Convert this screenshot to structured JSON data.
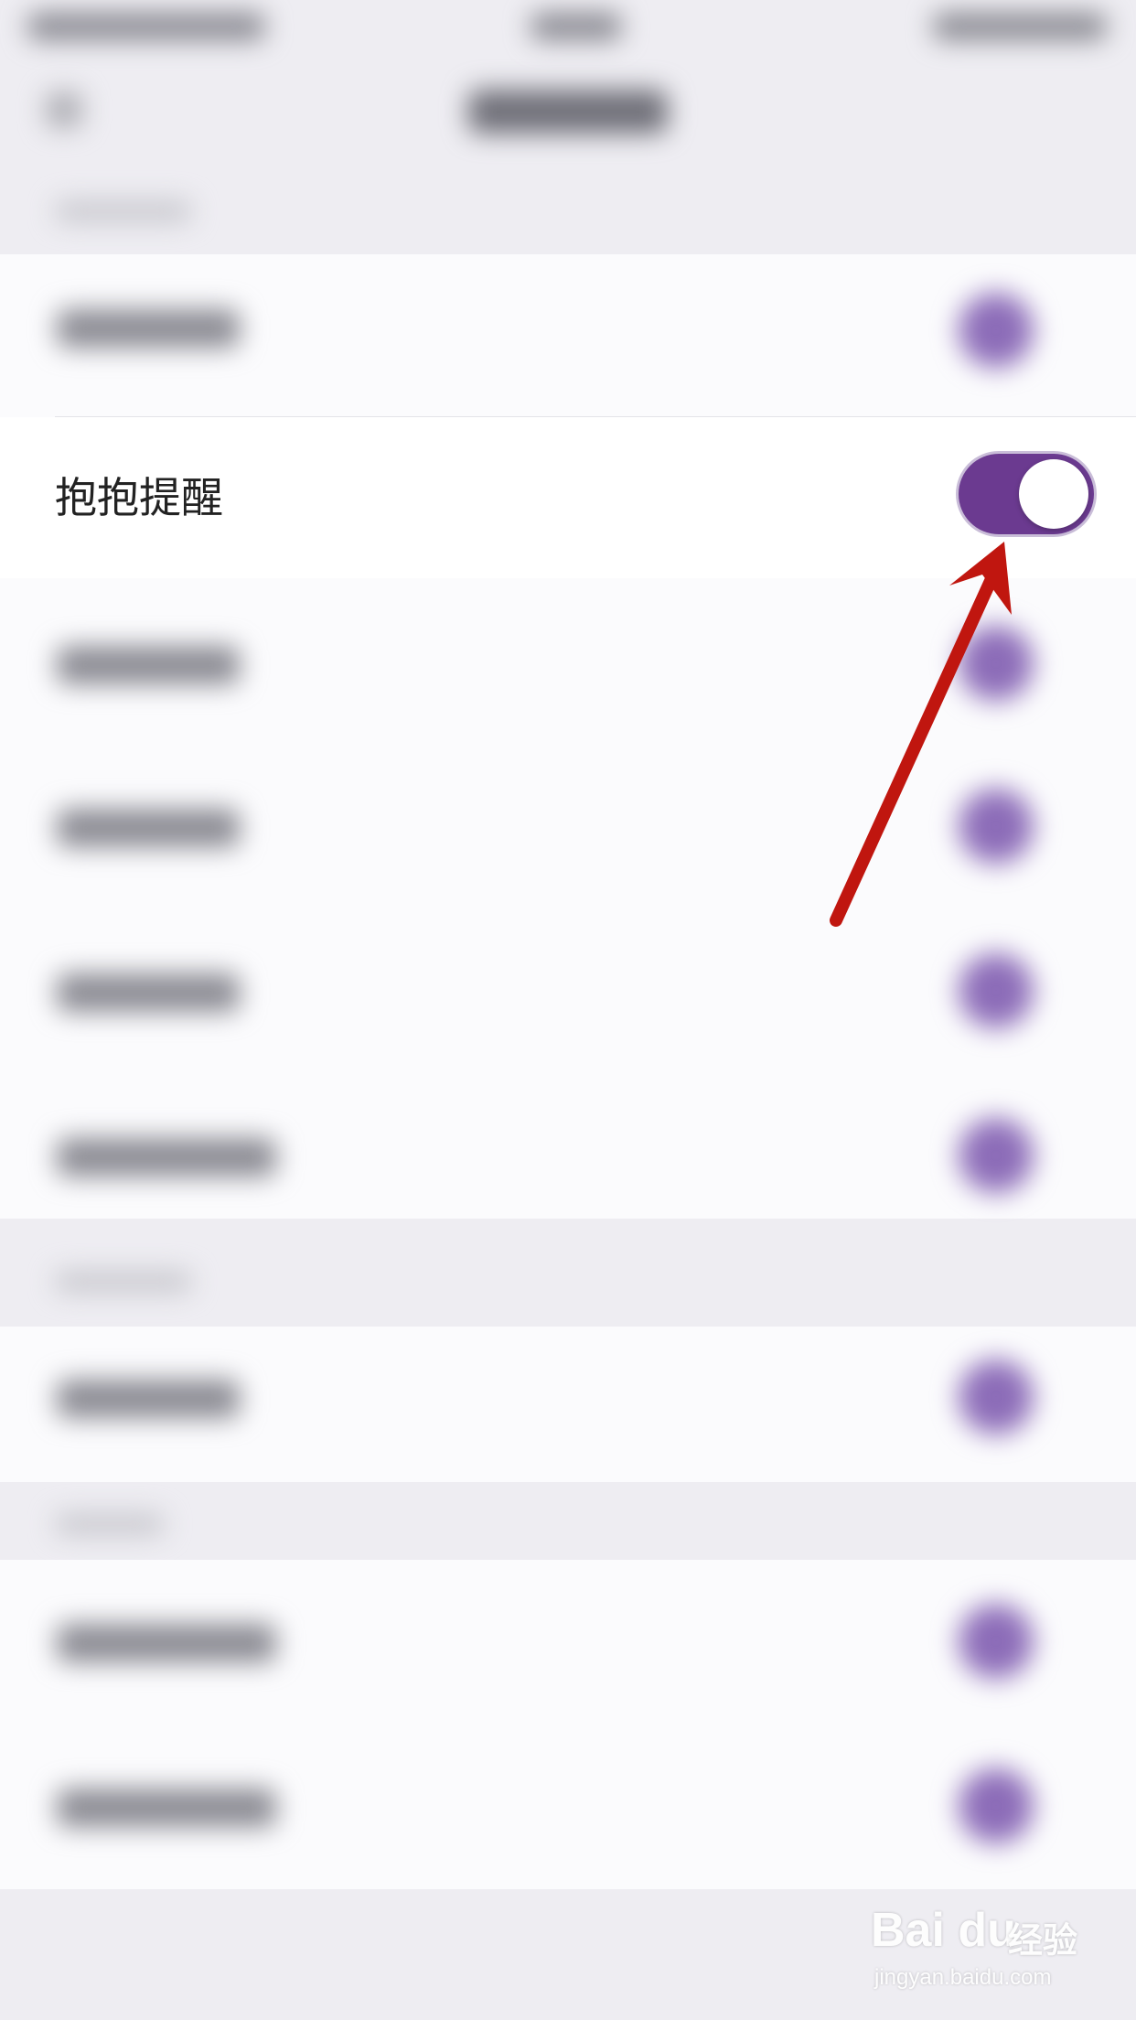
{
  "settings": {
    "highlighted_item": {
      "label": "抱抱提醒",
      "toggle_on": true
    }
  },
  "colors": {
    "toggle_on": "#6b3a90",
    "annotation_arrow": "#c0160f",
    "blurred_toggle": "#8c6cb8"
  },
  "annotation": {
    "icon": "red-arrow-icon"
  },
  "watermark": {
    "logo": "Bai du",
    "brand_cn": "经验",
    "url": "jingyan.baidu.com"
  }
}
